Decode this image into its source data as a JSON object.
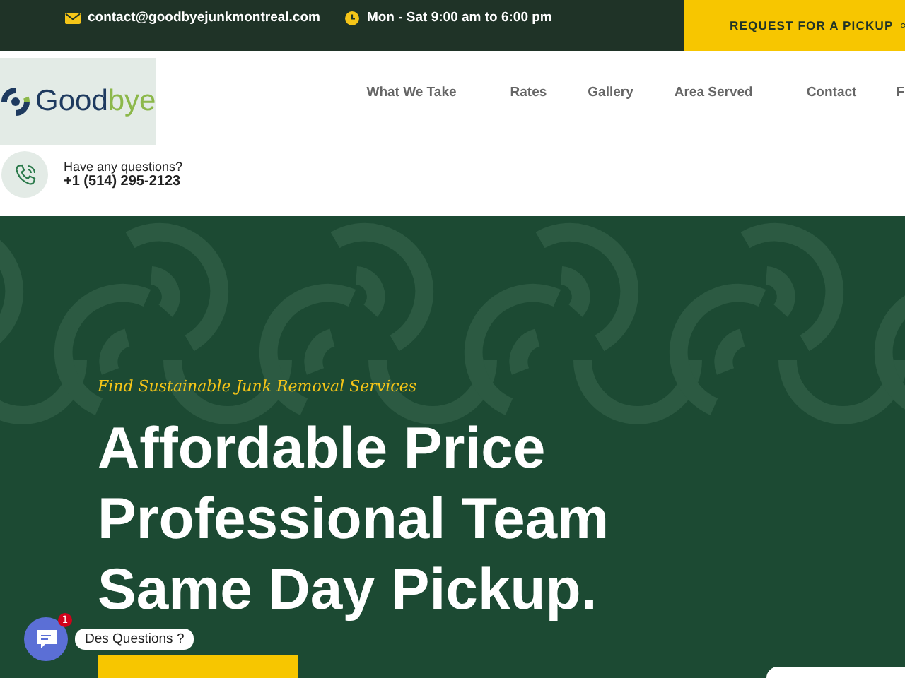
{
  "top_bar": {
    "email": "contact@goodbyejunkmontreal.com",
    "hours": "Mon - Sat 9:00 am to 6:00 pm",
    "cta": "REQUEST FOR A PICKUP"
  },
  "header": {
    "logo_text_dark": "Good",
    "logo_text_light": "bye",
    "nav": [
      {
        "label": "What We Take"
      },
      {
        "label": "Rates"
      },
      {
        "label": "Gallery"
      },
      {
        "label": "Area Served"
      },
      {
        "label": "Contact"
      },
      {
        "label": "F"
      }
    ],
    "contact": {
      "question": "Have any questions?",
      "phone": "+1 (514) 295-2123"
    }
  },
  "hero": {
    "tagline": "Find Sustainable Junk Removal Services",
    "headline": [
      "Affordable Price",
      "Professional Team",
      "Same Day Pickup."
    ]
  },
  "chat": {
    "badge": "1",
    "label": "Des Questions ?"
  }
}
